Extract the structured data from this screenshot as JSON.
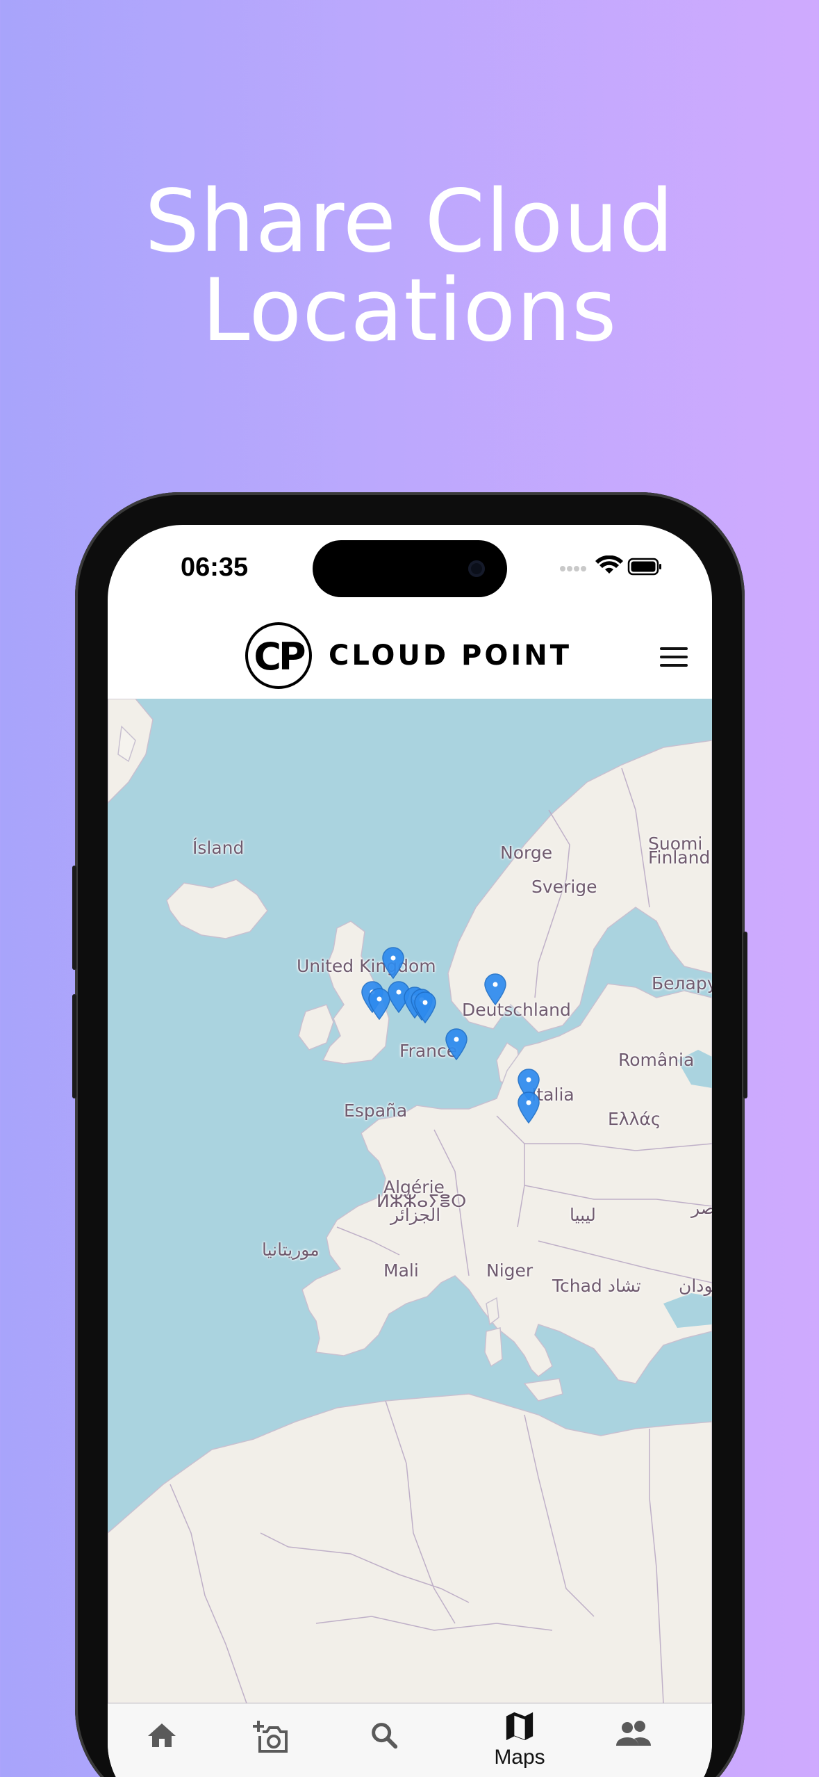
{
  "promo": {
    "headline_line1": "Share Cloud",
    "headline_line2": "Locations"
  },
  "status_bar": {
    "time": "06:35"
  },
  "header": {
    "logo_text": "CP",
    "brand_name": "CLOUD POINT"
  },
  "map": {
    "labels": {
      "iceland": "Ísland",
      "norway": "Norge",
      "sweden": "Sverige",
      "finland_line1": "Suomi",
      "finland_line2": "Finland",
      "uk": "United Kingdom",
      "germany": "Deutschland",
      "belarus": "Белару",
      "france": "France",
      "romania": "România",
      "italy": "Italia",
      "spain": "España",
      "greece": "Ελλάς",
      "algeria_line1": "Algérie",
      "algeria_line2": "ⵍⵣⵣⴰⵢⴻⵔ",
      "algeria_line3": "الجزائر",
      "libya": "ليبيا",
      "egypt": "مصر",
      "mauritania": "موريتانيا",
      "mali": "Mali",
      "niger": "Niger",
      "chad": "Tchad تشاد",
      "sudan": "السودان"
    },
    "marker_color": "#2e8bef",
    "marker_count": 11
  },
  "tab_bar": {
    "active_label": "Maps",
    "items": [
      "home",
      "add-photo",
      "search",
      "maps",
      "people"
    ]
  }
}
